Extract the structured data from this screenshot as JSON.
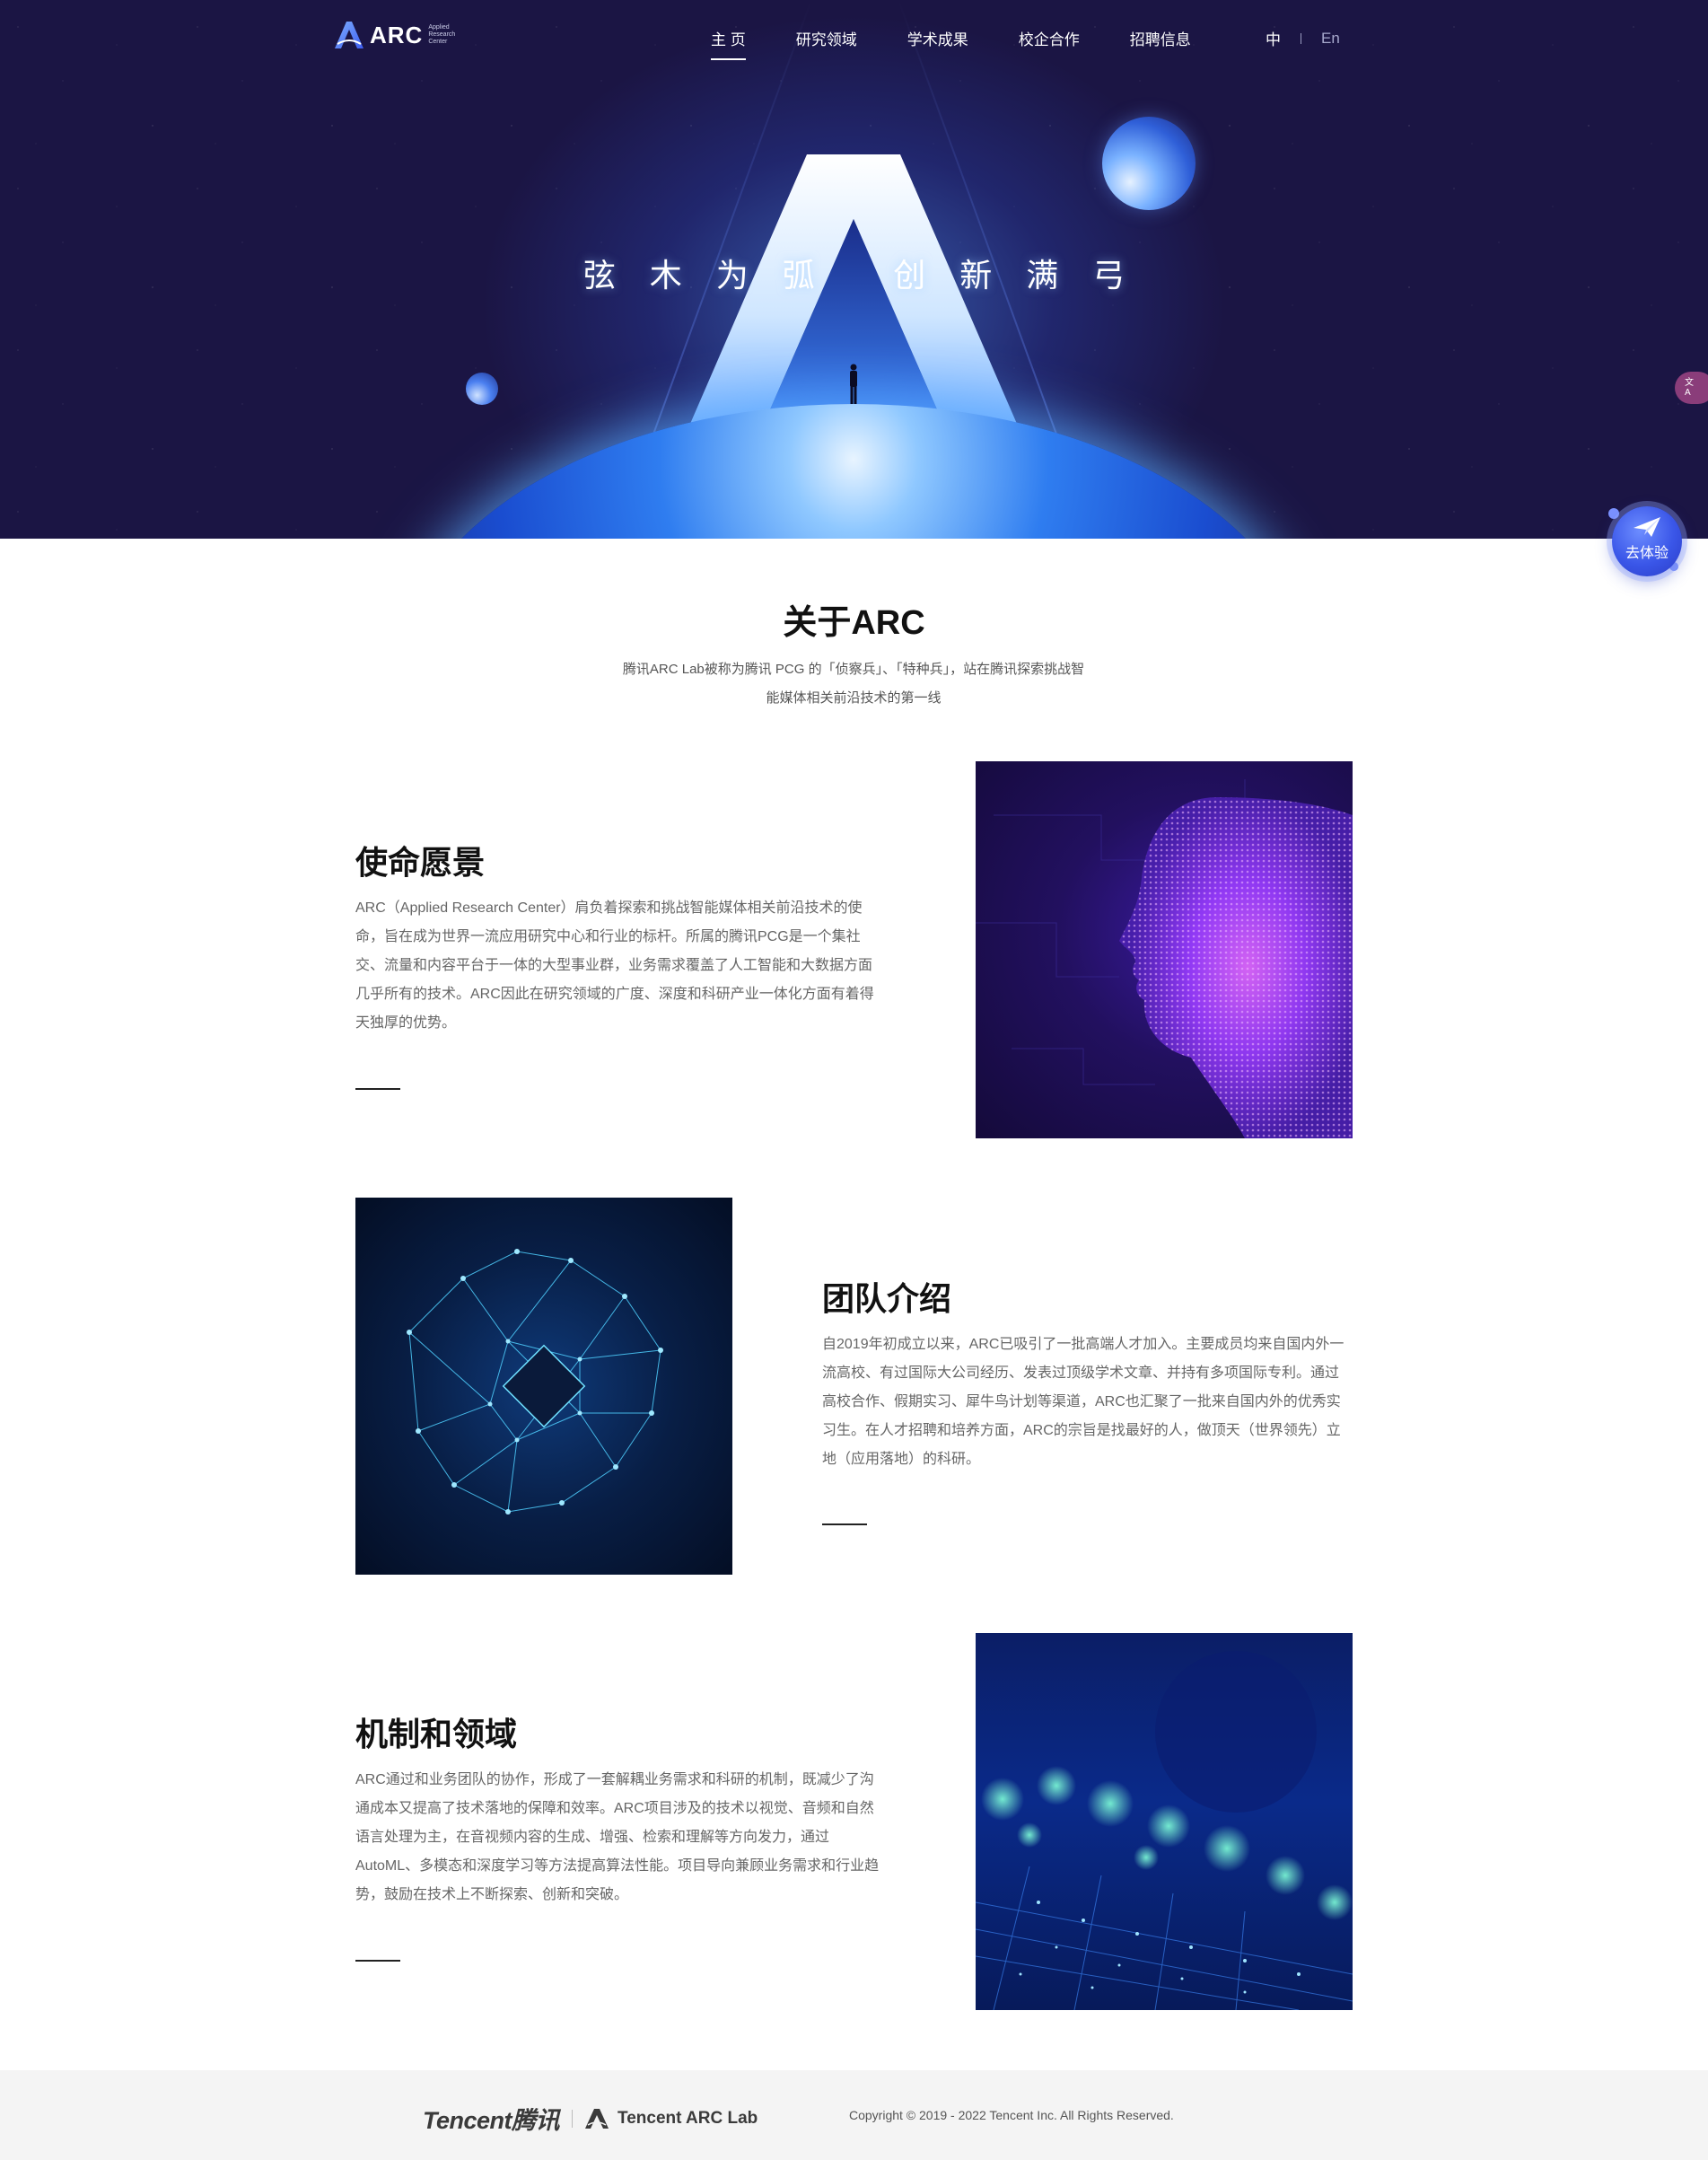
{
  "nav": {
    "logo_text": "ARC",
    "logo_sub": "Applied Research Center",
    "items": [
      {
        "label": "主 页",
        "active": true
      },
      {
        "label": "研究领域",
        "active": false
      },
      {
        "label": "学术成果",
        "active": false
      },
      {
        "label": "校企合作",
        "active": false
      },
      {
        "label": "招聘信息",
        "active": false
      }
    ],
    "lang_zh": "中",
    "lang_en": "En"
  },
  "hero": {
    "slogan": "弦木为弧 创新满弓"
  },
  "widgets": {
    "side_badge": "中\n:A",
    "try_label": "去体验"
  },
  "about": {
    "title": "关于ARC",
    "desc_line1": "腾讯ARC Lab被称为腾讯 PCG 的「侦察兵」、「特种兵」，站在腾讯探索挑战智",
    "desc_line2": "能媒体相关前沿技术的第一线"
  },
  "sections": {
    "mission": {
      "title": "使命愿景",
      "text": "ARC（Applied Research Center）肩负着探索和挑战智能媒体相关前沿技术的使命，旨在成为世界一流应用研究中心和行业的标杆。所属的腾讯PCG是一个集社交、流量和内容平台于一体的大型事业群，业务需求覆盖了人工智能和大数据方面几乎所有的技术。ARC因此在研究领域的广度、深度和科研产业一体化方面有着得天独厚的优势。"
    },
    "team": {
      "title": "团队介绍",
      "text": "自2019年初成立以来，ARC已吸引了一批高端人才加入。主要成员均来自国内外一流高校、有过国际大公司经历、发表过顶级学术文章、并持有多项国际专利。通过高校合作、假期实习、犀牛鸟计划等渠道，ARC也汇聚了一批来自国内外的优秀实习生。在人才招聘和培养方面，ARC的宗旨是找最好的人，做顶天（世界领先）立地（应用落地）的科研。"
    },
    "mechanism": {
      "title": "机制和领域",
      "text": "ARC通过和业务团队的协作，形成了一套解耦业务需求和科研的机制，既减少了沟通成本又提高了技术落地的保障和效率。ARC项目涉及的技术以视觉、音频和自然语言处理为主，在音视频内容的生成、增强、检索和理解等方向发力，通过AutoML、多模态和深度学习等方法提高算法性能。项目导向兼顾业务需求和行业趋势，鼓励在技术上不断探索、创新和突破。"
    }
  },
  "footer": {
    "tencent": "Tencent腾讯",
    "arc_lab": "Tencent  ARC Lab",
    "copyright": "Copyright © 2019 - 2022 Tencent Inc. All Rights Reserved."
  },
  "colors": {
    "hero_bg": "#1b1544",
    "accent_blue": "#3a56e8",
    "text_dark": "#111111",
    "text_body": "#666666",
    "footer_bg": "#f4f4f4"
  }
}
